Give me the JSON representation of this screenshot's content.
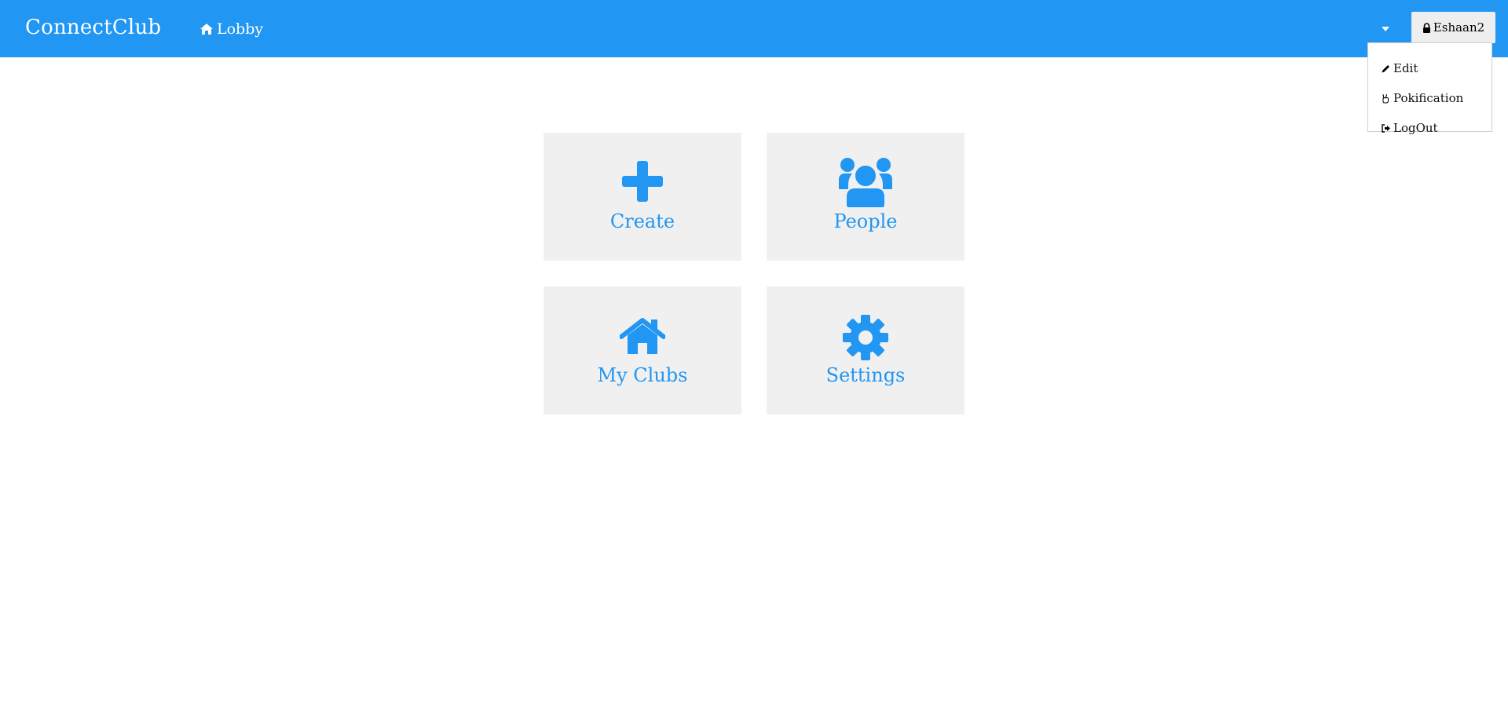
{
  "navbar": {
    "brand": "ConnectClub",
    "lobby_label": "Lobby",
    "user_label": "Eshaan2",
    "accent": "#2196F3"
  },
  "user_menu": {
    "items": [
      {
        "label": "Edit",
        "icon": "pencil-icon"
      },
      {
        "label": "Pokification",
        "icon": "peace-hand-icon"
      },
      {
        "label": "LogOut",
        "icon": "sign-out-icon"
      }
    ]
  },
  "tiles": [
    {
      "label": "Create",
      "icon": "plus-icon"
    },
    {
      "label": "People",
      "icon": "users-icon"
    },
    {
      "label": "My Clubs",
      "icon": "home-icon"
    },
    {
      "label": "Settings",
      "icon": "gear-icon"
    }
  ]
}
